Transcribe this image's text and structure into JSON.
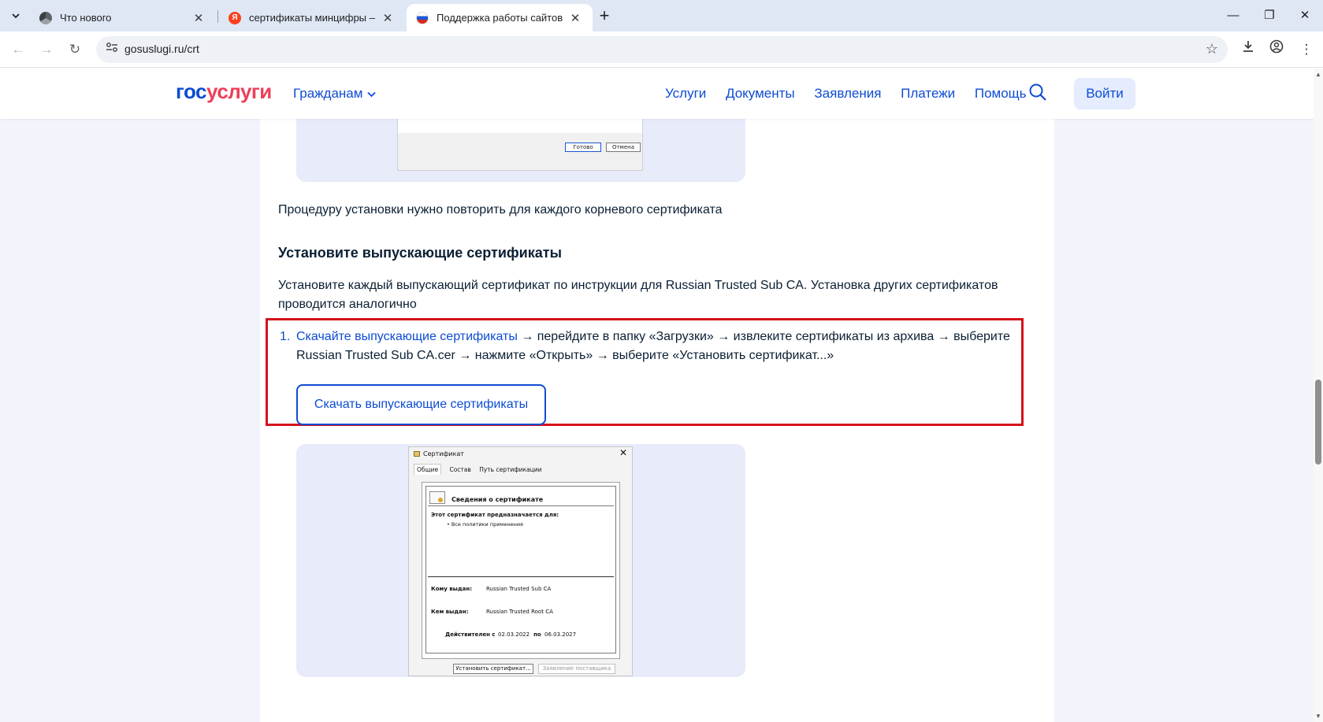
{
  "browser": {
    "tabs": [
      {
        "title": "Что нового",
        "active": false
      },
      {
        "title": "сертификаты минцифры — Ян",
        "active": false
      },
      {
        "title": "Поддержка работы сайтов с р",
        "active": true
      }
    ],
    "url": "gosuslugi.ru/crt"
  },
  "header": {
    "logo_gos": "гос",
    "logo_uslugi": "услуги",
    "audience_menu": "Гражданам",
    "nav": [
      "Услуги",
      "Документы",
      "Заявления",
      "Платежи",
      "Помощь"
    ],
    "login": "Войти"
  },
  "image1": {
    "ok_button": "Готово",
    "cancel_button": "Отмена"
  },
  "content": {
    "repeat_note": "Процедуру установки нужно повторить для каждого корневого сертификата",
    "section_title": "Установите выпускающие сертификаты",
    "section_intro": "Установите каждый выпускающий сертификат по инструкции для Russian Trusted Sub CA. Установка других сертификатов проводится аналогично",
    "step1_number": "1.",
    "step1_link": "Скачайте выпускающие сертификаты",
    "step1_text": " → перейдите в папку «Загрузки» → извлеките сертификаты из архива → выберите Russian Trusted Sub CA.cer → нажмите «Открыть» → выберите «Установить сертификат...»",
    "download_button": "Скачать выпускающие сертификаты"
  },
  "cert_dialog": {
    "caption": "Сертификат",
    "tabs": [
      "Общие",
      "Состав",
      "Путь сертификации"
    ],
    "info_title": "Сведения о сертификате",
    "purpose_title": "Этот сертификат предназначается для:",
    "purpose_item": "• Все политики применения",
    "issued_to_label": "Кому выдан:",
    "issued_to_value": "Russian Trusted Sub CA",
    "issued_by_label": "Кем выдан:",
    "issued_by_value": "Russian Trusted Root CA",
    "valid_from_label": "Действителен с",
    "valid_from": "02.03.2022",
    "valid_to_label": "по",
    "valid_to": "06.03.2027",
    "install_button": "Установить сертификат...",
    "issuer_statement_button": "Заявление поставщика"
  }
}
